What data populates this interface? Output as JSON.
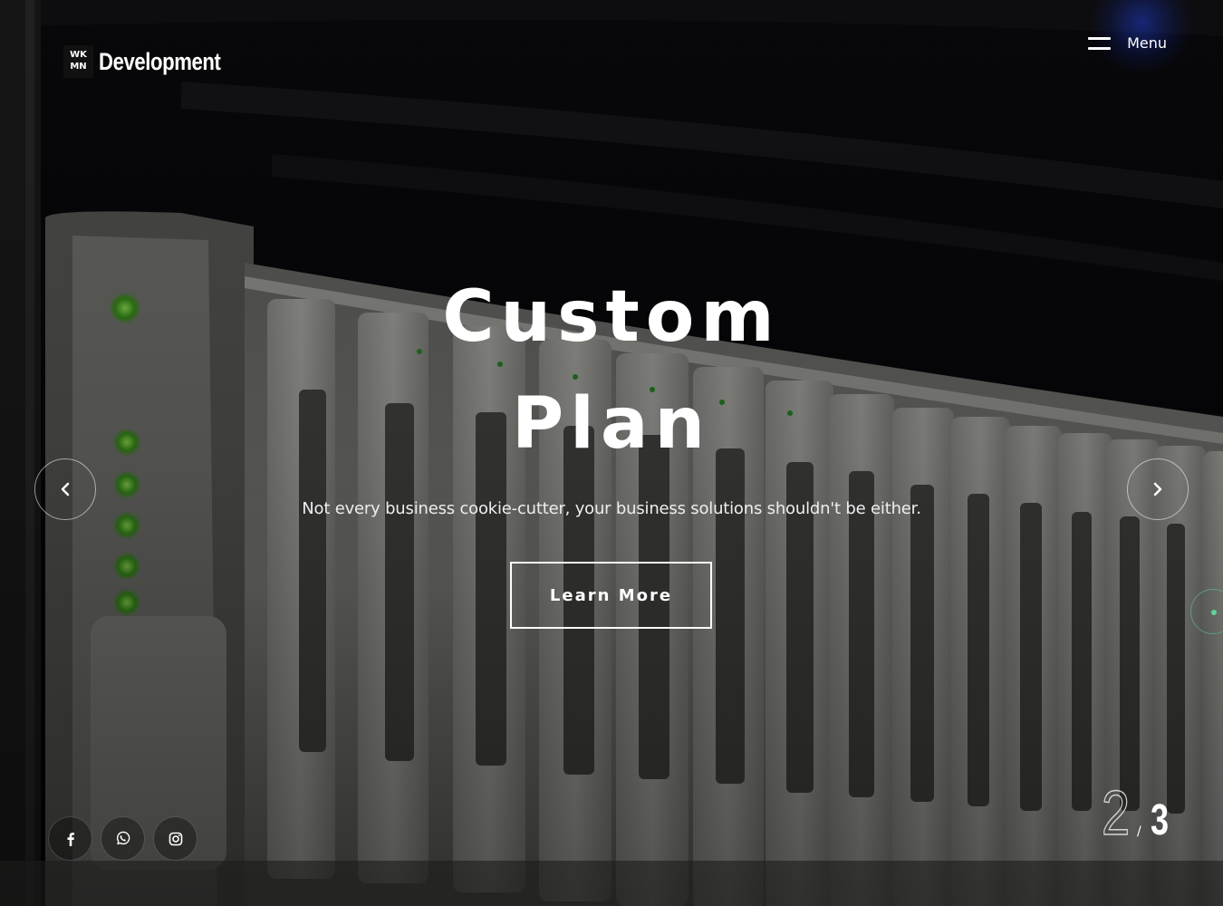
{
  "header": {
    "logo_mark": [
      "WK",
      "MN"
    ],
    "logo_text": "Development",
    "menu_label": "Menu"
  },
  "slide": {
    "title_line1": "Custom",
    "title_line2": "Plan",
    "subtitle": "Not every business cookie-cutter, your business solutions shouldn't be either.",
    "cta_label": "Learn More"
  },
  "slider": {
    "current": "2",
    "separator": "/",
    "total": "3"
  },
  "social": {
    "items": [
      "facebook-icon",
      "whatsapp-icon",
      "instagram-icon"
    ]
  },
  "colors": {
    "accent_green": "#5fd39a",
    "text": "#ffffff",
    "background": "#000000"
  }
}
